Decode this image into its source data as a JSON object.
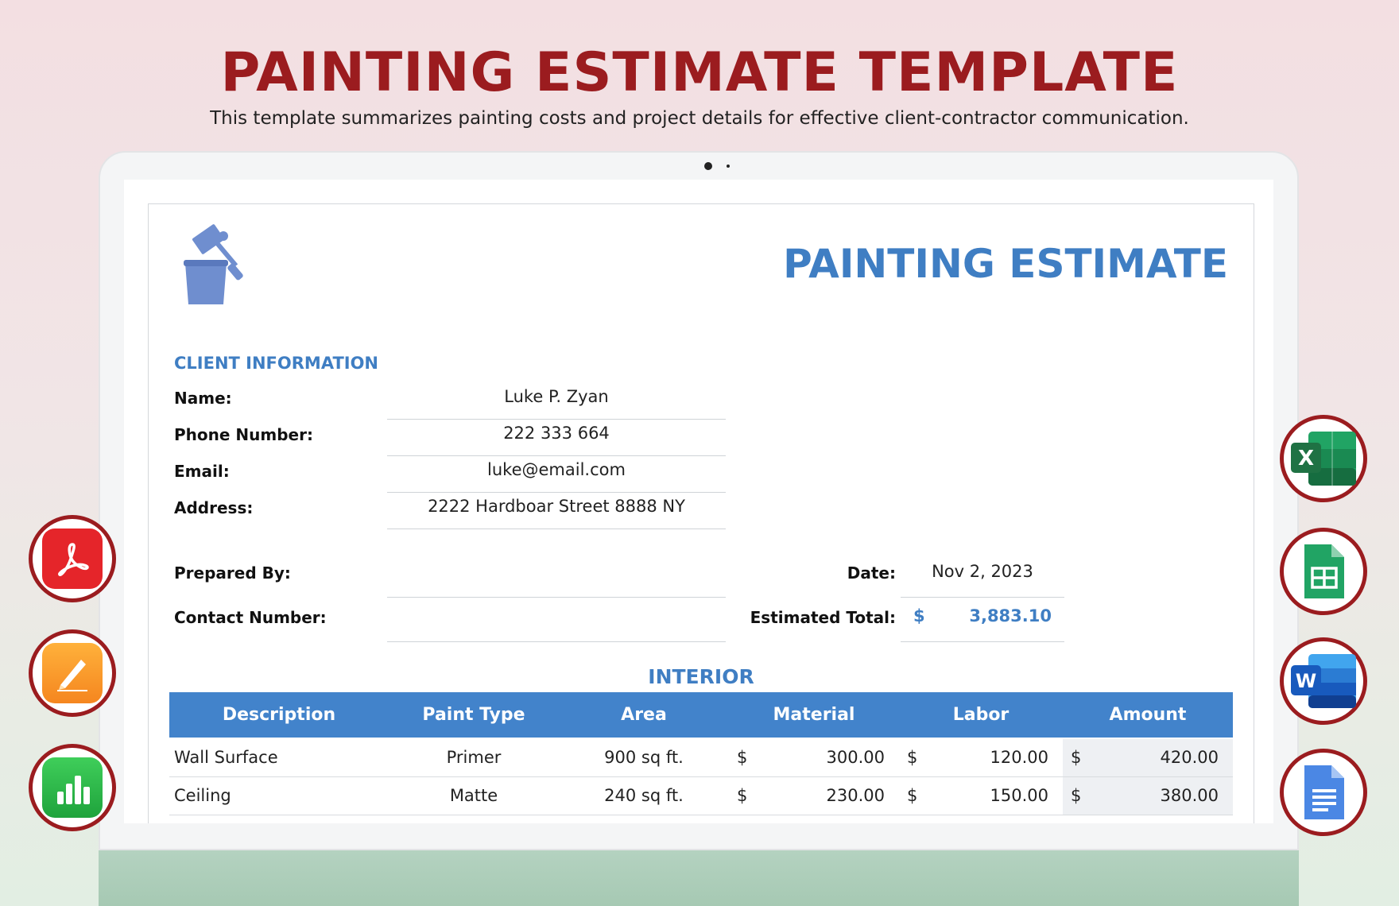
{
  "hero": {
    "title": "PAINTING ESTIMATE TEMPLATE",
    "subtitle": "This template summarizes painting costs and project details for effective client-contractor communication."
  },
  "document": {
    "title": "PAINTING ESTIMATE",
    "client_section": "CLIENT INFORMATION",
    "client": {
      "name_label": "Name:",
      "name": "Luke P. Zyan",
      "phone_label": "Phone Number:",
      "phone": "222 333 664",
      "email_label": "Email:",
      "email": "luke@email.com",
      "address_label": "Address:",
      "address": "2222 Hardboar Street 8888 NY"
    },
    "prepared_by_label": "Prepared By:",
    "prepared_by": "",
    "contact_label": "Contact Number:",
    "contact": "",
    "date_label": "Date:",
    "date": "Nov 2, 2023",
    "total_label": "Estimated Total:",
    "total_currency": "$",
    "total": "3,883.10",
    "interior": {
      "title": "INTERIOR",
      "headers": [
        "Description",
        "Paint Type",
        "Area",
        "Material",
        "Labor",
        "Amount"
      ],
      "rows": [
        {
          "description": "Wall Surface",
          "paint_type": "Primer",
          "area": "900 sq ft.",
          "material_cur": "$",
          "material": "300.00",
          "labor_cur": "$",
          "labor": "120.00",
          "amount_cur": "$",
          "amount": "420.00"
        },
        {
          "description": "Ceiling",
          "paint_type": "Matte",
          "area": "240 sq ft.",
          "material_cur": "$",
          "material": "230.00",
          "labor_cur": "$",
          "labor": "150.00",
          "amount_cur": "$",
          "amount": "380.00"
        }
      ]
    }
  },
  "apps_left": [
    {
      "icon": "pdf-icon",
      "color": "#e5252a"
    },
    {
      "icon": "pages-icon",
      "color": "#f5931f"
    },
    {
      "icon": "numbers-icon",
      "color": "#2fb44a"
    }
  ],
  "apps_right": [
    {
      "icon": "excel-icon",
      "color": "#1f7244",
      "glyph": "X"
    },
    {
      "icon": "sheets-icon",
      "color": "#21a464"
    },
    {
      "icon": "word-icon",
      "color": "#2b5796",
      "glyph": "W"
    },
    {
      "icon": "docs-icon",
      "color": "#4b87e4"
    }
  ],
  "colors": {
    "accent": "#3f7ec3",
    "header_bg": "#4283cb",
    "brand_red": "#9b1c1f"
  }
}
